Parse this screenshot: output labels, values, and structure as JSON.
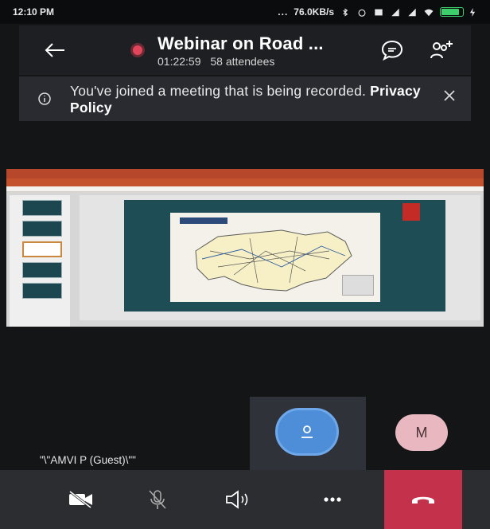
{
  "status_bar": {
    "time": "12:10 PM",
    "network_speed": "76.0KB/s",
    "icons": [
      "bluetooth-icon",
      "alarm-icon",
      "signal-icon",
      "wifi-icon",
      "battery-icon",
      "charging-icon"
    ],
    "battery_level": 0.85
  },
  "header": {
    "title": "Webinar on Road ...",
    "duration": "01:22:59",
    "attendees": "58 attendees",
    "recording_color": "#e0455c"
  },
  "banner": {
    "message": "You've joined a meeting that is being recorded.",
    "link_label": "Privacy Policy"
  },
  "shared_screen": {
    "app": "PowerPoint",
    "thumbnail_count": 5,
    "active_thumbnail": 3
  },
  "participants": {
    "guest_name": "\"\\\"AMVI P (Guest)\\\"\"",
    "avatar_initial": "M",
    "self_avatar_color": "#4e8ed8",
    "other_avatar_color": "#e9b7c0"
  },
  "controls": {
    "items": [
      "camera-off-icon",
      "mic-off-icon",
      "speaker-icon",
      "more-icon",
      "hang-up-icon"
    ],
    "hangup_color": "#c4314b"
  }
}
